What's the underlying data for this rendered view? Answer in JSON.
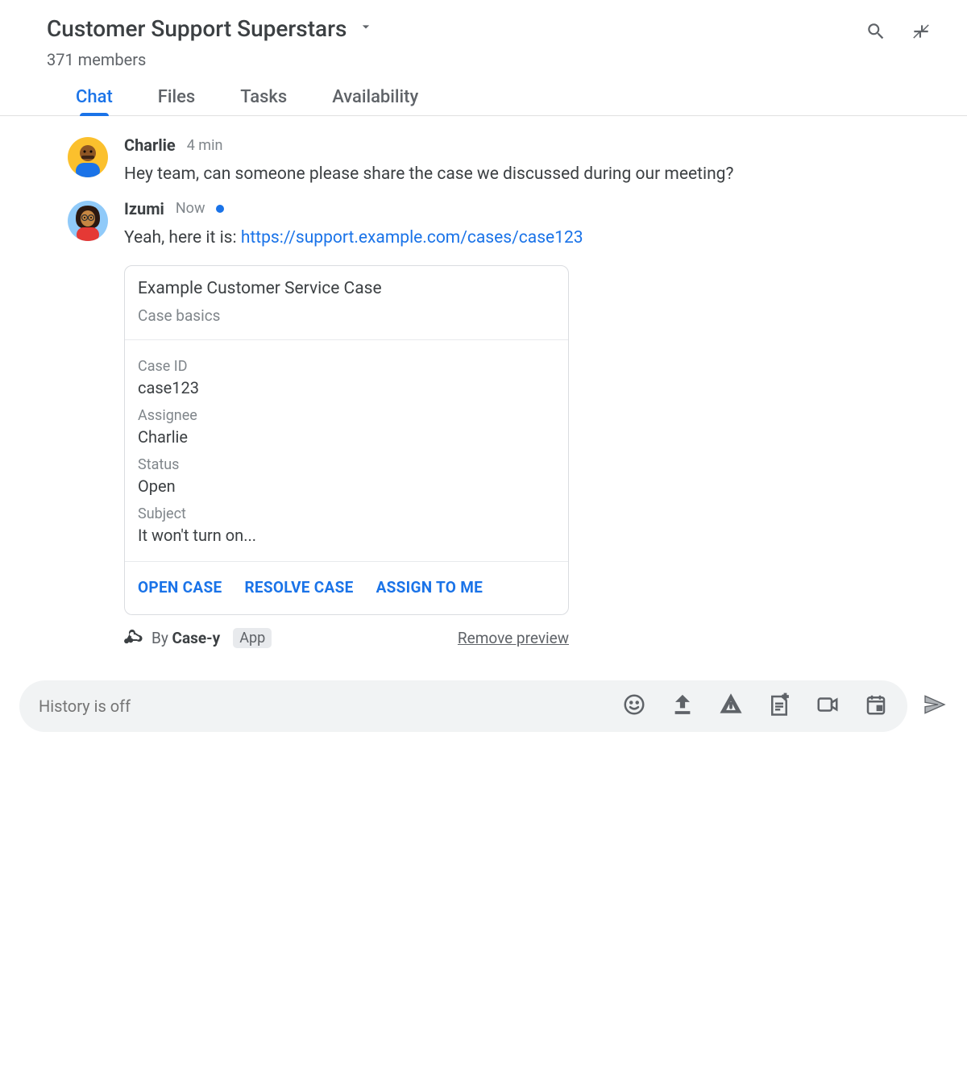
{
  "header": {
    "title": "Customer Support Superstars",
    "members_text": "371 members"
  },
  "tabs": [
    {
      "label": "Chat",
      "active": true
    },
    {
      "label": "Files",
      "active": false
    },
    {
      "label": "Tasks",
      "active": false
    },
    {
      "label": "Availability",
      "active": false
    }
  ],
  "messages": {
    "msg1": {
      "author": "Charlie",
      "time": "4 min",
      "text": "Hey team, can someone please share the case we discussed during our meeting?"
    },
    "msg2": {
      "author": "Izumi",
      "time": "Now",
      "text_prefix": "Yeah, here it is: ",
      "link": "https://support.example.com/cases/case123"
    }
  },
  "card": {
    "title": "Example Customer Service Case",
    "subtitle": "Case basics",
    "fields": {
      "case_id": {
        "label": "Case ID",
        "value": "case123"
      },
      "assignee": {
        "label": "Assignee",
        "value": "Charlie"
      },
      "status": {
        "label": "Status",
        "value": "Open"
      },
      "subject": {
        "label": "Subject",
        "value": "It won't turn on..."
      }
    },
    "actions": {
      "open": "OPEN CASE",
      "resolve": "RESOLVE CASE",
      "assign": "ASSIGN TO ME"
    }
  },
  "preview_footer": {
    "by_prefix": "By ",
    "app_name": "Case-y",
    "app_badge": "App",
    "remove": "Remove preview"
  },
  "composer": {
    "placeholder": "History is off"
  }
}
